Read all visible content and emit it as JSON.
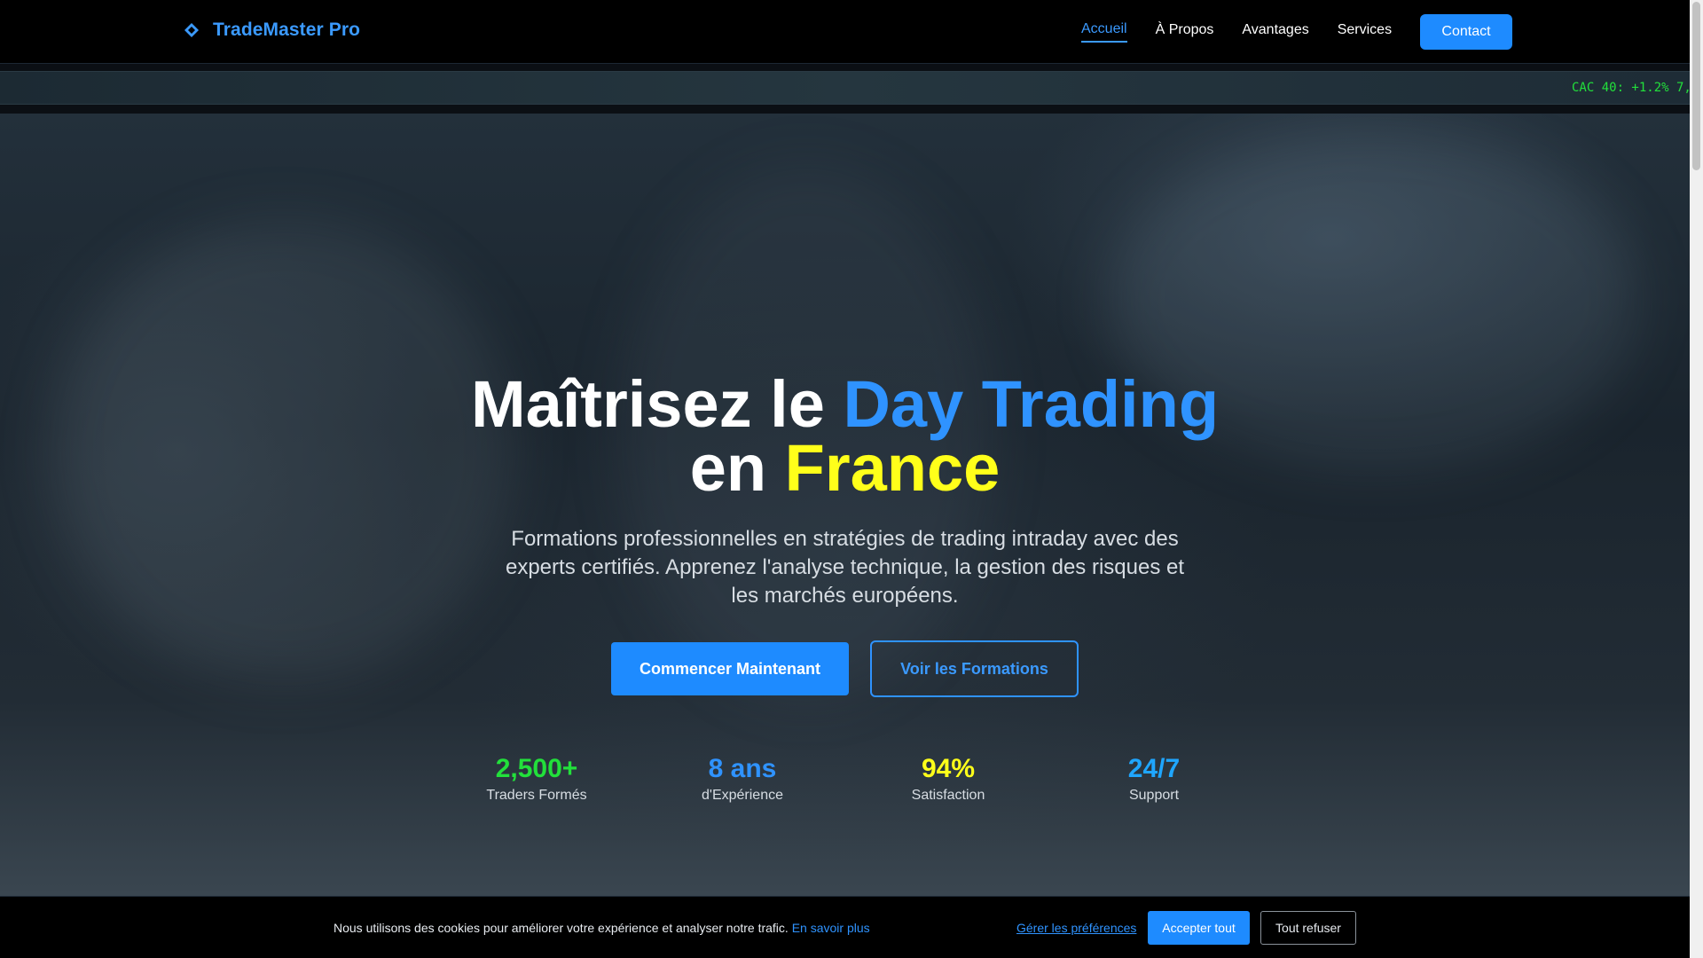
{
  "nav": {
    "brand": "TradeMaster Pro",
    "brand_icon": "diamond-outline-icon",
    "links": [
      "Accueil",
      "À Propos",
      "Avantages",
      "Services"
    ],
    "contact": "Contact",
    "active_index": 0
  },
  "ticker": {
    "text": "CAC 40: +1.2% 7,"
  },
  "hero": {
    "title_part1": "Maîtrisez le ",
    "title_highlight1": "Day Trading",
    "title_part2": "en ",
    "title_highlight2": "France",
    "subtitle": "Formations professionnelles en stratégies de trading intraday avec des experts certifiés. Apprenez l'analyse technique, la gestion des risques et les marchés européens.",
    "cta_primary": "Commencer Maintenant",
    "cta_secondary": "Voir les Formations"
  },
  "stats": [
    {
      "value": "2,500+",
      "label": "Traders Formés",
      "color": "#22e03b"
    },
    {
      "value": "8 ans",
      "label": "d'Expérience",
      "color": "#2f93ff"
    },
    {
      "value": "94%",
      "label": "Satisfaction",
      "color": "#ffff1a"
    },
    {
      "value": "24/7",
      "label": "Support",
      "color": "#1fa6ff"
    }
  ],
  "cookie": {
    "text": "Nous utilisons des cookies pour améliorer votre expérience et analyser notre trafic.",
    "learn_more": "En savoir plus",
    "preferences": "Gérer les préférences",
    "accept": "Accepter tout",
    "refuse": "Tout refuser"
  },
  "colors": {
    "accent_blue": "#1e8bff",
    "accent_yellow": "#ffff1a",
    "accent_green": "#22e03b"
  }
}
